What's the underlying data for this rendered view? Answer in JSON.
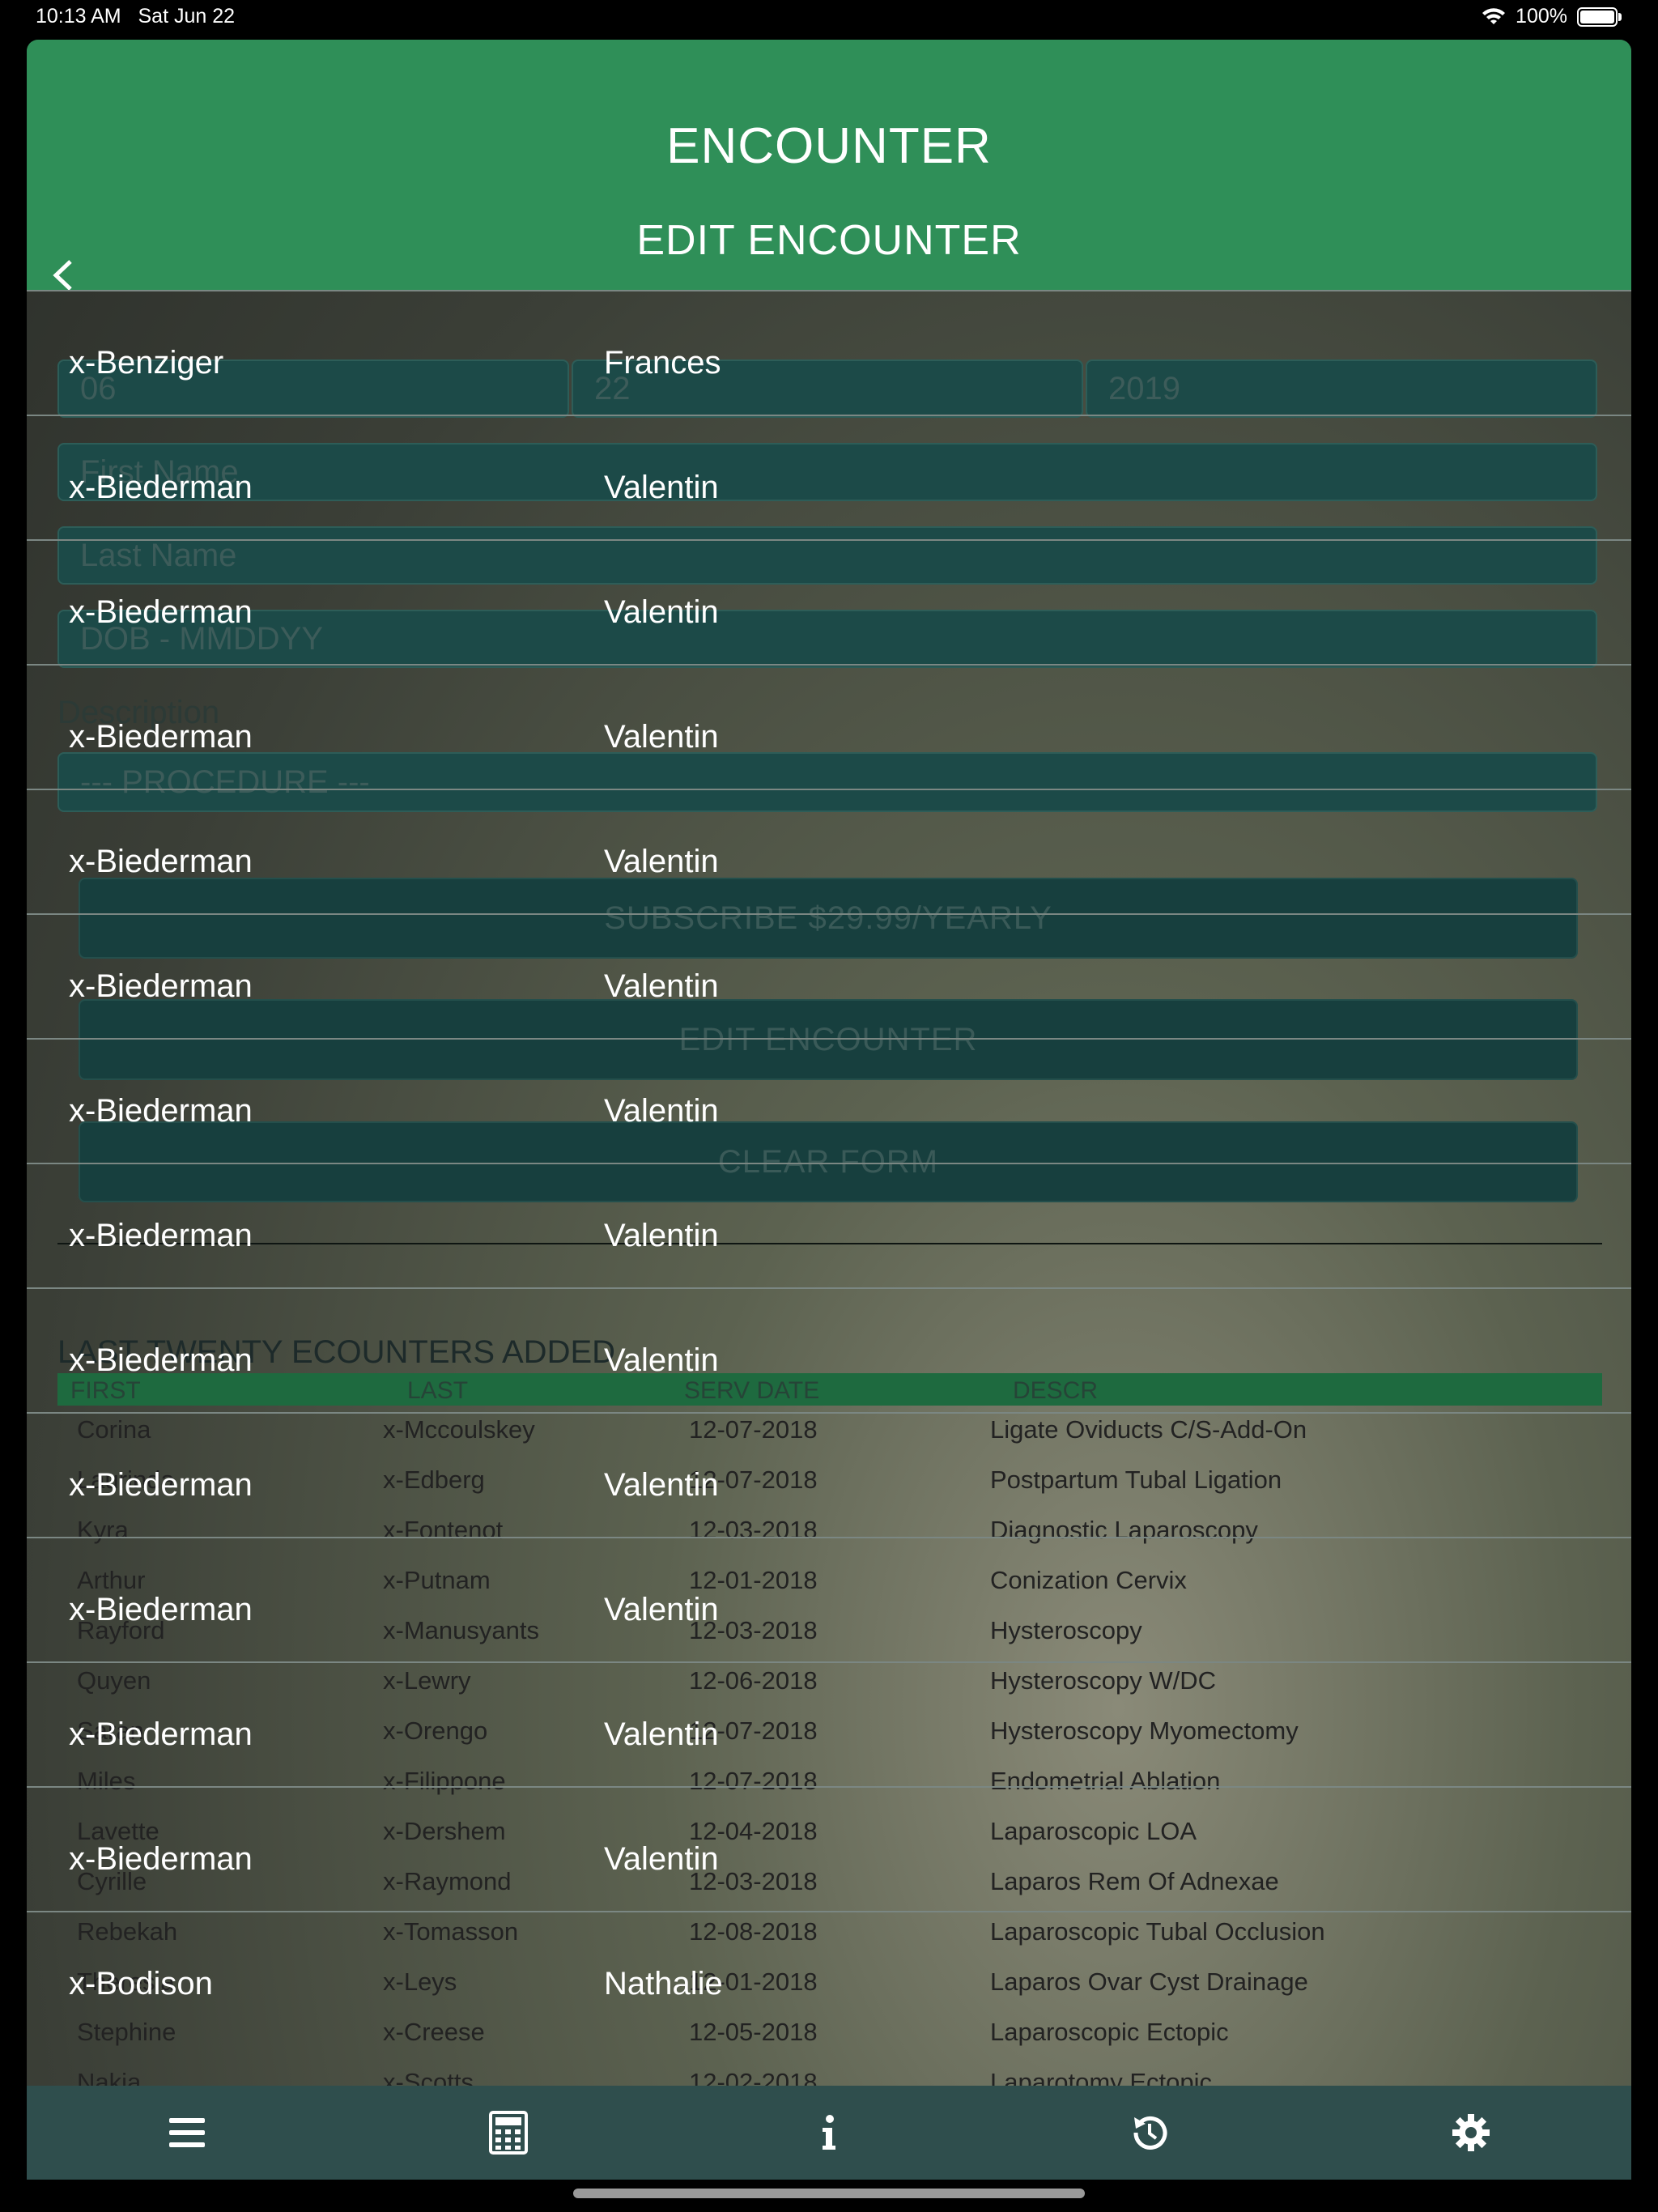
{
  "status": {
    "time": "10:13 AM",
    "date": "Sat Jun 22",
    "battery": "100%",
    "battery_level": 1.0
  },
  "header": {
    "title": "ENCOUNTER",
    "subtitle": "EDIT ENCOUNTER"
  },
  "form": {
    "date_month": "06",
    "date_day": "22",
    "date_year": "2019",
    "first_name_placeholder": "First Name",
    "last_name_placeholder": "Last Name",
    "dob_placeholder": "DOB - MMDDYY",
    "description_label": "Description",
    "procedure_placeholder": "--- PROCEDURE ---",
    "subscribe_label": "SUBSCRIBE $29.99/YEARLY",
    "edit_label": "EDIT ENCOUNTER",
    "clear_label": "CLEAR FORM"
  },
  "recent": {
    "title": "LAST TWENTY ECOUNTERS ADDED",
    "columns": [
      "FIRST",
      "LAST",
      "SERV DATE",
      "DESCR"
    ],
    "rows": [
      {
        "first": "Corina",
        "last": "x-Mccoulskey",
        "date": "12-07-2018",
        "descr": "Ligate Oviducts C/S-Add-On"
      },
      {
        "first": "Laurinda",
        "last": "x-Edberg",
        "date": "12-07-2018",
        "descr": "Postpartum Tubal Ligation"
      },
      {
        "first": "Kyra",
        "last": "x-Fontenot",
        "date": "12-03-2018",
        "descr": "Diagnostic Laparoscopy"
      },
      {
        "first": "Arthur",
        "last": "x-Putnam",
        "date": "12-01-2018",
        "descr": "Conization Cervix"
      },
      {
        "first": "Rayford",
        "last": "x-Manusyants",
        "date": "12-03-2018",
        "descr": "Hysteroscopy"
      },
      {
        "first": "Quyen",
        "last": "x-Lewry",
        "date": "12-06-2018",
        "descr": "Hysteroscopy W/DC"
      },
      {
        "first": "Saran",
        "last": "x-Orengo",
        "date": "12-07-2018",
        "descr": "Hysteroscopy Myomectomy"
      },
      {
        "first": "Miles",
        "last": "x-Filippone",
        "date": "12-07-2018",
        "descr": "Endometrial Ablation"
      },
      {
        "first": "Lavette",
        "last": "x-Dershem",
        "date": "12-04-2018",
        "descr": "Laparoscopic LOA"
      },
      {
        "first": "Cyrille",
        "last": "x-Raymond",
        "date": "12-03-2018",
        "descr": "Laparos Rem Of Adnexae"
      },
      {
        "first": "Rebekah",
        "last": "x-Tomasson",
        "date": "12-08-2018",
        "descr": "Laparoscopic Tubal Occlusion"
      },
      {
        "first": "Theresia",
        "last": "x-Leys",
        "date": "12-01-2018",
        "descr": "Laparos Ovar Cyst Drainage"
      },
      {
        "first": "Stephine",
        "last": "x-Creese",
        "date": "12-05-2018",
        "descr": "Laparoscopic Ectopic"
      },
      {
        "first": "Nakia",
        "last": "x-Scotts",
        "date": "12-02-2018",
        "descr": "Laparotomy Ectopic"
      }
    ]
  },
  "patients": [
    {
      "last": "x-Benziger",
      "first": "Frances"
    },
    {
      "last": "x-Biederman",
      "first": "Valentin"
    },
    {
      "last": "x-Biederman",
      "first": "Valentin"
    },
    {
      "last": "x-Biederman",
      "first": "Valentin"
    },
    {
      "last": "x-Biederman",
      "first": "Valentin"
    },
    {
      "last": "x-Biederman",
      "first": "Valentin"
    },
    {
      "last": "x-Biederman",
      "first": "Valentin"
    },
    {
      "last": "x-Biederman",
      "first": "Valentin"
    },
    {
      "last": "x-Biederman",
      "first": "Valentin"
    },
    {
      "last": "x-Biederman",
      "first": "Valentin"
    },
    {
      "last": "x-Biederman",
      "first": "Valentin"
    },
    {
      "last": "x-Biederman",
      "first": "Valentin"
    },
    {
      "last": "x-Biederman",
      "first": "Valentin"
    },
    {
      "last": "x-Bodison",
      "first": "Nathalie"
    }
  ],
  "tabs": [
    {
      "icon": "menu-icon"
    },
    {
      "icon": "calculator-icon"
    },
    {
      "icon": "info-icon"
    },
    {
      "icon": "history-icon"
    },
    {
      "icon": "gear-icon"
    }
  ]
}
